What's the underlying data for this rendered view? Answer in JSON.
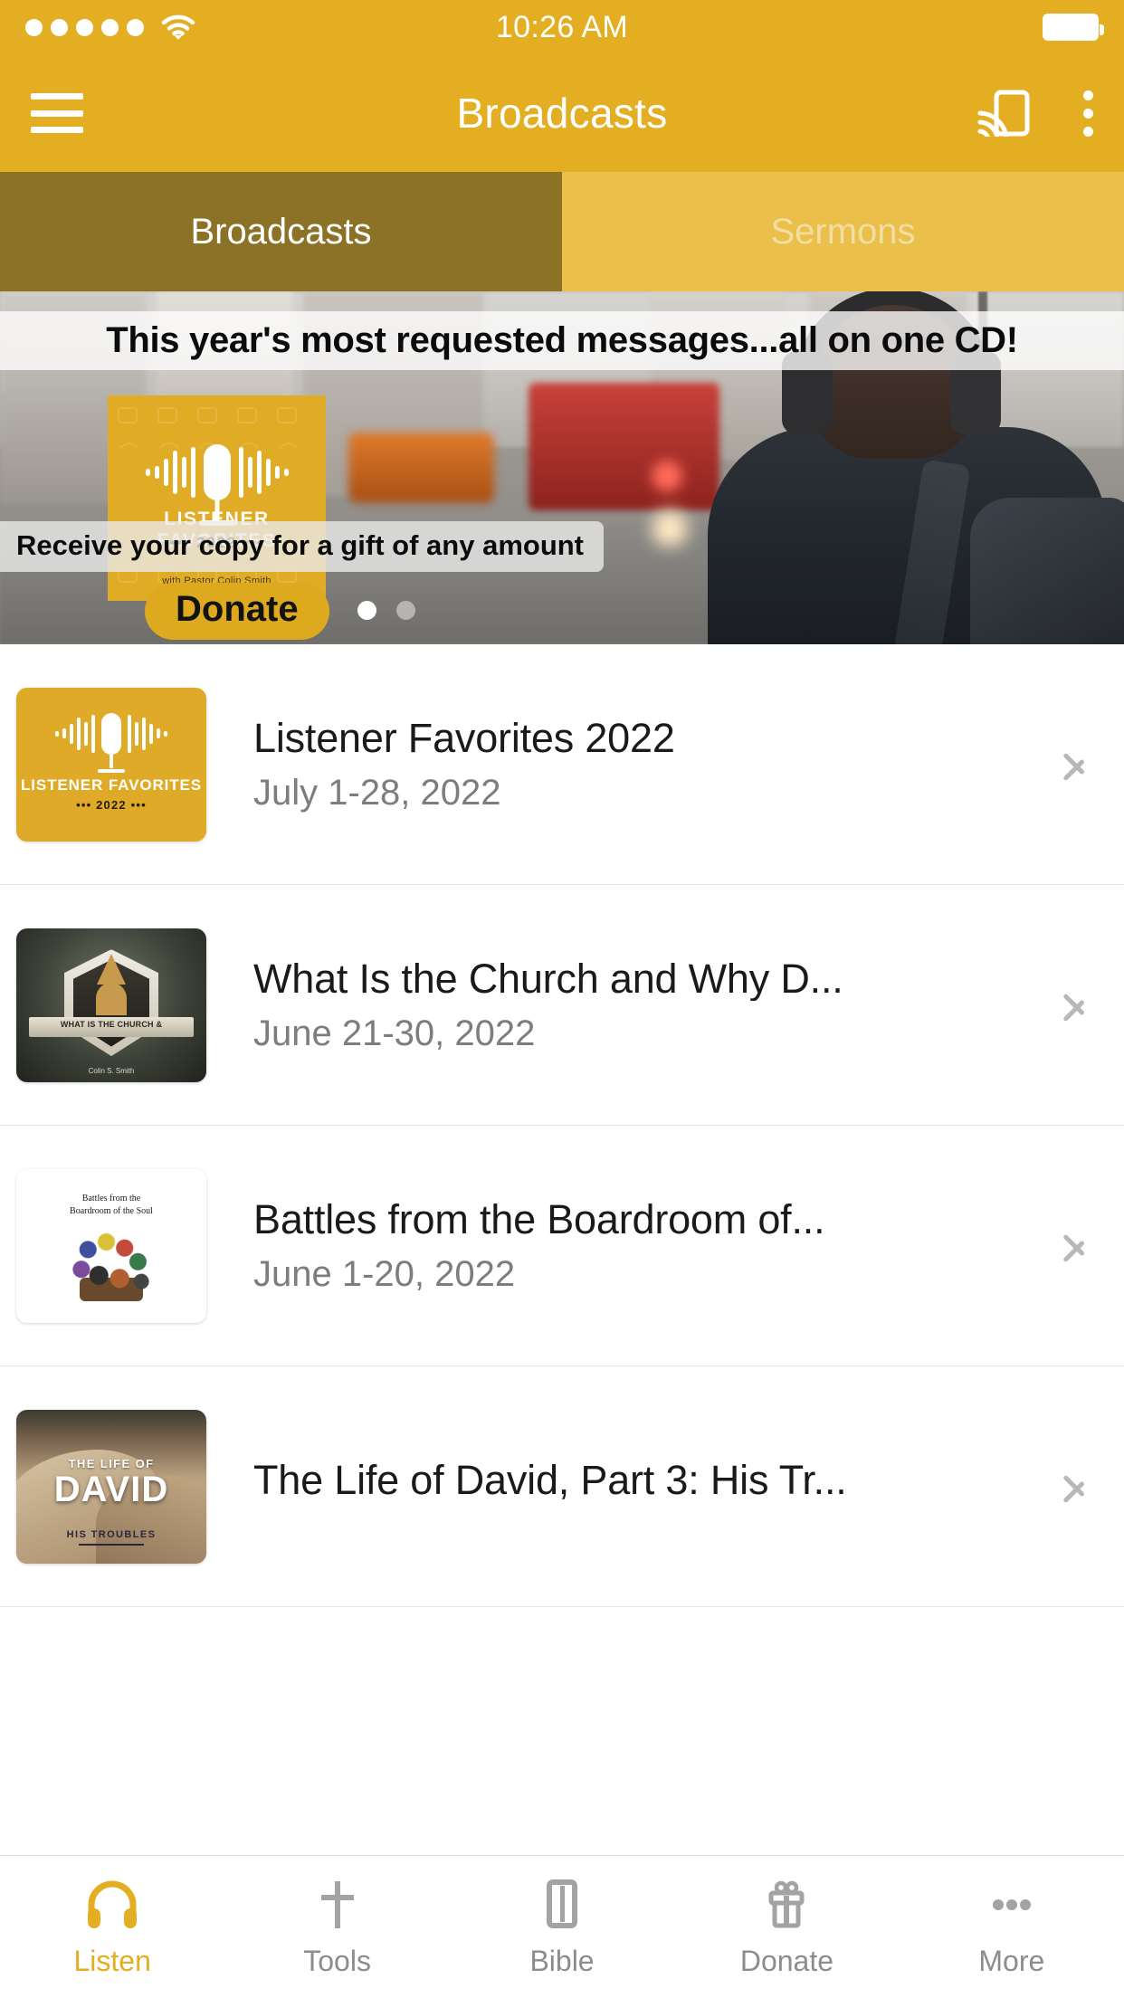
{
  "statusbar": {
    "time": "10:26 AM",
    "signal_icon": "signal-dots-icon",
    "wifi_icon": "wifi-icon",
    "battery_icon": "battery-full-icon"
  },
  "appbar": {
    "title": "Broadcasts",
    "menu_icon": "hamburger-menu-icon",
    "cast_icon": "chromecast-icon",
    "overflow_icon": "kebab-menu-icon",
    "background_color": "#E3AE22"
  },
  "segment_tabs": {
    "active_color": "#8C7226",
    "inactive_color": "#EABF4A",
    "items": [
      {
        "label": "Broadcasts",
        "active": true
      },
      {
        "label": "Sermons",
        "active": false
      }
    ]
  },
  "hero": {
    "headline": "This year's most requested messages...all on one CD!",
    "caption": "Receive your copy for a gift of any amount",
    "donate_label": "Donate",
    "donate_color": "#DDA91F",
    "album": {
      "title_line1": "LISTENER FAVORITES",
      "title_line2": "••• 2022 •••",
      "byline": "with Pastor Colin Smith",
      "background_color": "#E0AB25",
      "mic_icon": "microphone-waveform-icon"
    },
    "carousel": {
      "total": 2,
      "current": 1
    }
  },
  "list": {
    "rows": [
      {
        "title": "Listener Favorites 2022",
        "date": "July 1-28, 2022",
        "thumb_name": "listener-favorites-2022-thumbnail",
        "thumb_line1": "LISTENER FAVORITES",
        "thumb_line2": "••• 2022 •••"
      },
      {
        "title": "What Is the Church and Why D...",
        "date": "June 21-30, 2022",
        "thumb_name": "what-is-the-church-thumbnail",
        "thumb_line1": "WHAT IS THE CHURCH &",
        "thumb_line2": "Colin S. Smith"
      },
      {
        "title": "Battles from the Boardroom of...",
        "date": "June 1-20, 2022",
        "thumb_name": "battles-boardroom-thumbnail",
        "thumb_line1": "Battles from the",
        "thumb_line2": "Boardroom of the Soul"
      },
      {
        "title": "The Life of David, Part 3: His Tr...",
        "date": "",
        "thumb_name": "life-of-david-thumbnail",
        "thumb_line1": "THE LIFE OF",
        "thumb_line2": "DAVID",
        "thumb_line3": "HIS TROUBLES"
      }
    ],
    "chevron_icon": "chevron-right-icon"
  },
  "bottomnav": {
    "active_color": "#E3AE22",
    "inactive_color": "#8c8c8c",
    "items": [
      {
        "label": "Listen",
        "icon": "headphones-icon",
        "active": true
      },
      {
        "label": "Tools",
        "icon": "cross-icon",
        "active": false
      },
      {
        "label": "Bible",
        "icon": "book-icon",
        "active": false
      },
      {
        "label": "Donate",
        "icon": "gift-icon",
        "active": false
      },
      {
        "label": "More",
        "icon": "ellipsis-icon",
        "active": false
      }
    ]
  }
}
